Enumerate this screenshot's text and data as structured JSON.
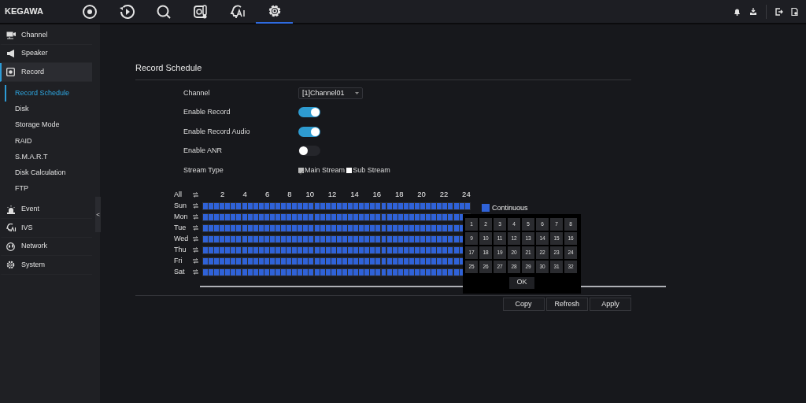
{
  "brand": "KEGAWA",
  "top_nav": [
    {
      "selected": false
    },
    {
      "selected": false
    },
    {
      "selected": false
    },
    {
      "selected": false
    },
    {
      "selected": false
    },
    {
      "selected": true
    }
  ],
  "sidebar": {
    "items": [
      {
        "label": "Channel",
        "selected": false
      },
      {
        "label": "Speaker",
        "selected": false
      },
      {
        "label": "Record",
        "selected": true,
        "expanded": true,
        "children": [
          {
            "label": "Record Schedule",
            "selected": true
          },
          {
            "label": "Disk",
            "selected": false
          },
          {
            "label": "Storage Mode",
            "selected": false
          },
          {
            "label": "RAID",
            "selected": false
          },
          {
            "label": "S.M.A.R.T",
            "selected": false
          },
          {
            "label": "Disk Calculation",
            "selected": false
          },
          {
            "label": "FTP",
            "selected": false
          }
        ]
      },
      {
        "label": "Event",
        "selected": false
      },
      {
        "label": "IVS",
        "selected": false
      },
      {
        "label": "Network",
        "selected": false
      },
      {
        "label": "System",
        "selected": false
      }
    ],
    "collapse_handle": "<"
  },
  "page_title": "Record Schedule",
  "form": [
    {
      "kind": "select",
      "label": "Channel",
      "value": "[1]Channel01"
    },
    {
      "kind": "switch",
      "label": "Enable Record",
      "on": true
    },
    {
      "kind": "switch",
      "label": "Enable Record Audio",
      "on": true
    },
    {
      "kind": "switch",
      "label": "Enable ANR",
      "on": false
    },
    {
      "kind": "checks",
      "label": "Stream Type",
      "options": [
        {
          "label": "Main Stream",
          "checked": true
        },
        {
          "label": "Sub Stream",
          "checked": false
        }
      ]
    }
  ],
  "schedule": {
    "all_label": "All",
    "hours": [
      "2",
      "4",
      "6",
      "8",
      "10",
      "12",
      "14",
      "16",
      "18",
      "20",
      "22",
      "24"
    ],
    "days": [
      {
        "day": "Sun"
      },
      {
        "day": "Mon"
      },
      {
        "day": "Tue"
      },
      {
        "day": "Wed"
      },
      {
        "day": "Thu"
      },
      {
        "day": "Fri"
      },
      {
        "day": "Sat"
      }
    ],
    "legend": [
      {
        "label": "Continuous",
        "color": "#2f62d8"
      }
    ]
  },
  "copy_popup": {
    "channels": [
      "1",
      "2",
      "3",
      "4",
      "5",
      "6",
      "7",
      "8",
      "9",
      "10",
      "11",
      "12",
      "13",
      "14",
      "15",
      "16",
      "17",
      "18",
      "19",
      "20",
      "21",
      "22",
      "23",
      "24",
      "25",
      "26",
      "27",
      "28",
      "29",
      "30",
      "31",
      "32"
    ],
    "ok": "OK"
  },
  "buttons": [
    "Copy",
    "Refresh",
    "Apply"
  ]
}
